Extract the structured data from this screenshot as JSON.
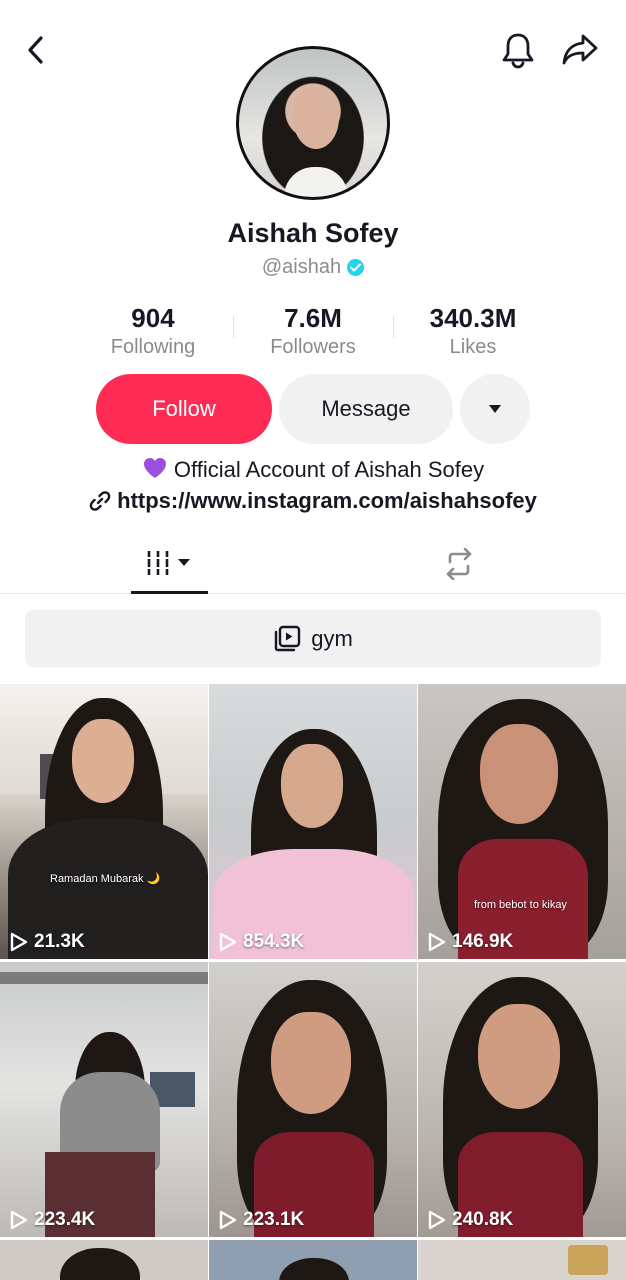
{
  "header": {
    "back_icon": "chevron-left-icon",
    "bell_icon": "bell-icon",
    "share_icon": "share-arrow-icon"
  },
  "profile": {
    "display_name": "Aishah Sofey",
    "handle": "@aishah",
    "verified": true,
    "verified_color": "#20d5ec"
  },
  "stats": [
    {
      "value": "904",
      "label": "Following"
    },
    {
      "value": "7.6M",
      "label": "Followers"
    },
    {
      "value": "340.3M",
      "label": "Likes"
    }
  ],
  "actions": {
    "follow_label": "Follow",
    "message_label": "Message",
    "follow_color": "#fe2c55"
  },
  "bio": {
    "emoji": "purple-heart",
    "text": "Official Account of Aishah Sofey",
    "link": "https://www.instagram.com/aishahsofey"
  },
  "tabs": {
    "active": "videos",
    "items": [
      "videos-grid-icon",
      "repost-icon"
    ]
  },
  "playlist": {
    "label": "gym",
    "icon": "playlist-icon"
  },
  "videos": [
    {
      "views": "21.3K",
      "caption": "Ramadan Mubarak 🌙"
    },
    {
      "views": "854.3K",
      "caption": ""
    },
    {
      "views": "146.9K",
      "caption": "from bebot to kikay"
    },
    {
      "views": "223.4K",
      "caption": ""
    },
    {
      "views": "223.1K",
      "caption": ""
    },
    {
      "views": "240.8K",
      "caption": ""
    }
  ]
}
